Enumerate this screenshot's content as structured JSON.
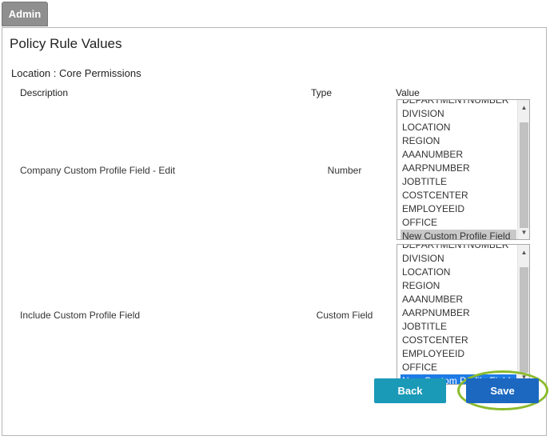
{
  "admin_tab": "Admin",
  "page_title": "Policy Rule Values",
  "location_line": "Location : Core Permissions",
  "columns": {
    "description": "Description",
    "type": "Type",
    "value": "Value"
  },
  "rows": [
    {
      "description": "Company Custom Profile Field - Edit",
      "type": "Number",
      "options": [
        "DEPARTMENTNUMBER",
        "DIVISION",
        "LOCATION",
        "REGION",
        "AAANUMBER",
        "AARPNUMBER",
        "JOBTITLE",
        "COSTCENTER",
        "EMPLOYEEID",
        "OFFICE",
        "New Custom Profile Field"
      ],
      "selected": "New Custom Profile Field",
      "selection_style": "gray"
    },
    {
      "description": "Include Custom Profile Field",
      "type": "Custom Field",
      "options": [
        "DEPARTMENTNUMBER",
        "DIVISION",
        "LOCATION",
        "REGION",
        "AAANUMBER",
        "AARPNUMBER",
        "JOBTITLE",
        "COSTCENTER",
        "EMPLOYEEID",
        "OFFICE",
        "New Custom Profile Field"
      ],
      "selected": "New Custom Profile Field",
      "selection_style": "blue"
    }
  ],
  "buttons": {
    "back": "Back",
    "save": "Save"
  },
  "colors": {
    "back": "#1b9ab8",
    "save": "#1c68c0",
    "highlight_ring": "#8bbb2d",
    "selected_blue": "#1e7be6"
  }
}
